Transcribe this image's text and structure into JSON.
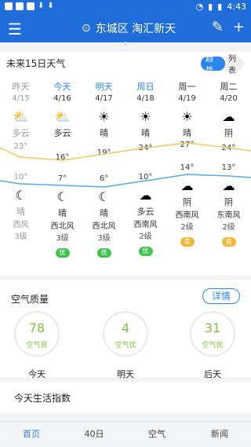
{
  "statusbar": {
    "time": "4:43"
  },
  "header": {
    "city": "东城区 淘汇新天"
  },
  "forecast": {
    "title": "未来15日天气",
    "toggle": {
      "on": "趋势",
      "off": "列表"
    },
    "days": [
      {
        "day": "昨天",
        "date": "4/15",
        "cond_day": "多云",
        "hi": "23°",
        "lo": "10°",
        "cond_night": "晴",
        "wind": "西风",
        "level": "3级",
        "aqi": ""
      },
      {
        "day": "今天",
        "date": "4/16",
        "cond_day": "多云",
        "hi": "16°",
        "lo": "7°",
        "cond_night": "晴",
        "wind": "西北风",
        "level": "3级",
        "aqi": "优"
      },
      {
        "day": "明天",
        "date": "4/17",
        "cond_day": "晴",
        "hi": "19°",
        "lo": "6°",
        "cond_night": "晴",
        "wind": "西北风",
        "level": "3级",
        "aqi": "优"
      },
      {
        "day": "周日",
        "date": "4/18",
        "cond_day": "晴",
        "hi": "24°",
        "lo": "10°",
        "cond_night": "多云",
        "wind": "西南风",
        "level": "2级",
        "aqi": "优"
      },
      {
        "day": "周一",
        "date": "4/19",
        "cond_day": "晴",
        "hi": "27°",
        "lo": "14°",
        "cond_night": "阴",
        "wind": "西南风",
        "level": "2级",
        "aqi": "良"
      },
      {
        "day": "周二",
        "date": "4/20",
        "cond_day": "阴",
        "hi": "24°",
        "lo": "13°",
        "cond_night": "阴",
        "wind": "东南风",
        "level": "2级",
        "aqi": "良"
      }
    ]
  },
  "air": {
    "title": "空气质量",
    "detail": "详情",
    "items": [
      {
        "value": "78",
        "label": "空气良",
        "name": "今天"
      },
      {
        "value": "4",
        "label": "空气优",
        "name": "明天"
      },
      {
        "value": "31",
        "label": "空气优",
        "name": "后天"
      }
    ]
  },
  "life": {
    "title": "今天生活指数"
  },
  "nav": [
    "首页",
    "40日",
    "空气",
    "新闻"
  ],
  "colors": {
    "primary": "#1f6dd8",
    "accent": "#2d86ef",
    "good": "#40c44f",
    "moderate": "#f1b83a"
  }
}
